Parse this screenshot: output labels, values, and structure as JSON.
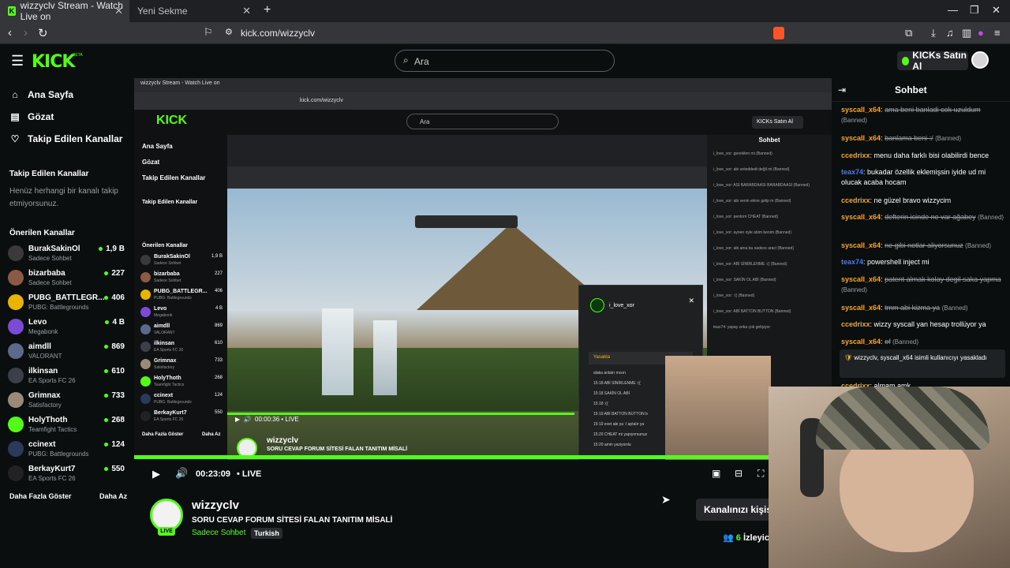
{
  "browser": {
    "tabs": [
      {
        "title": "wizzyclv Stream - Watch Live on"
      },
      {
        "title": "Yeni Sekme"
      }
    ],
    "url": "kick.com/wizzyclv"
  },
  "header": {
    "logo": "KICK",
    "logo_tag": "BETA",
    "search_placeholder": "Ara",
    "kicks_button": "KICKs Satın Al"
  },
  "sidebar": {
    "nav": [
      {
        "label": "Ana Sayfa",
        "icon": "home-icon"
      },
      {
        "label": "Gözat",
        "icon": "browse-icon"
      },
      {
        "label": "Takip Edilen Kanallar",
        "icon": "heart-icon"
      }
    ],
    "followed_title": "Takip Edilen Kanallar",
    "followed_empty": "Henüz herhangi bir kanalı takip etmiyorsunuz.",
    "recommended_title": "Önerilen Kanallar",
    "channels": [
      {
        "name": "BurakSakinOl",
        "category": "Sadece Sohbet",
        "viewers": "1,9 B",
        "color": "#3a3a3a"
      },
      {
        "name": "bizarbaba",
        "category": "Sadece Sohbet",
        "viewers": "227",
        "color": "#8a5a44"
      },
      {
        "name": "PUBG_BATTLEGR...",
        "category": "PUBG: Battlegrounds",
        "viewers": "406",
        "color": "#e8b400"
      },
      {
        "name": "Levo",
        "category": "Megabonk",
        "viewers": "4 B",
        "color": "#7b4bd6"
      },
      {
        "name": "aimdll",
        "category": "VALORANT",
        "viewers": "869",
        "color": "#5a6a8a"
      },
      {
        "name": "ilkinsan",
        "category": "EA Sports FC 26",
        "viewers": "610",
        "color": "#3a3f4a"
      },
      {
        "name": "Grimnax",
        "category": "Satisfactory",
        "viewers": "733",
        "color": "#9a8a7a"
      },
      {
        "name": "HolyThoth",
        "category": "Teamfight Tactics",
        "viewers": "268",
        "color": "#53fc18"
      },
      {
        "name": "ccinext",
        "category": "PUBG: Battlegrounds",
        "viewers": "124",
        "color": "#2a3a5a"
      },
      {
        "name": "BerkayKurt7",
        "category": "EA Sports FC 26",
        "viewers": "550",
        "color": "#222"
      }
    ],
    "show_more": "Daha Fazla Göster",
    "show_less": "Daha Az"
  },
  "player": {
    "elapsed": "00:23:09",
    "live_label": "LIVE",
    "inner_elapsed": "00:00:36"
  },
  "stream": {
    "streamer": "wizzyclv",
    "title": "SORU CEVAP FORUM SİTESİ FALAN TANITIM MİSALİ",
    "category": "Sadece Sohbet",
    "language": "Turkish",
    "live_badge": "LIVE",
    "customize_button": "Kanalınızı kişise",
    "viewers_count": "6",
    "viewers_label": "İzleyici"
  },
  "chat": {
    "title": "Sohbet",
    "messages": [
      {
        "user": "syscall_x64",
        "color": "#f5a623",
        "text": "ama beni banladi cok uzuldum",
        "deleted": true,
        "tag": "(Banned)"
      },
      {
        "user": "syscall_x64",
        "color": "#f5a623",
        "text": "banlama beni :/",
        "deleted": true,
        "tag": "(Banned)"
      },
      {
        "user": "ccedrixx",
        "color": "#f5a623",
        "text": "menu daha farklı bisi olabilirdi bence",
        "deleted": false,
        "tag": ""
      },
      {
        "user": "teax74",
        "color": "#4b7bec",
        "text": "bukadar özellik eklemişsin iyide ud mi olucak acaba hocam",
        "deleted": false,
        "tag": ""
      },
      {
        "user": "ccedrixx",
        "color": "#f5a623",
        "text": "ne güzel bravo wizzycim",
        "deleted": false,
        "tag": ""
      },
      {
        "user": "syscall_x64",
        "color": "#f5a623",
        "text": "defterin icinde ne var ağabey",
        "deleted": true,
        "tag": "(Banned)"
      },
      {
        "user": "syscall_x64",
        "color": "#f5a623",
        "text": "ne gibi notlar aliyorsunuz",
        "deleted": true,
        "tag": "(Banned)"
      },
      {
        "user": "teax74",
        "color": "#4b7bec",
        "text": "powershell inject mi",
        "deleted": false,
        "tag": ""
      },
      {
        "user": "syscall_x64",
        "color": "#f5a623",
        "text": "patent almak kolay degil saka yapma",
        "deleted": true,
        "tag": "(Banned)"
      },
      {
        "user": "syscall_x64",
        "color": "#f5a623",
        "text": "tmm abi kizma ya",
        "deleted": true,
        "tag": "(Banned)"
      },
      {
        "user": "ccedrixx",
        "color": "#f5a623",
        "text": "wizzy syscall yan hesap trollüyor ya",
        "deleted": false,
        "tag": ""
      },
      {
        "user": "syscall_x64",
        "color": "#f5a623",
        "text": "of",
        "deleted": true,
        "tag": "(Banned)"
      }
    ],
    "system": "wizzyclv, syscall_x64 isimli kullanıcıyı yasakladı",
    "partial": {
      "user": "ccedrixx",
      "text": "almam amk"
    }
  },
  "inner": {
    "tab_title": "wizzyclv Stream - Watch Live on",
    "url": "kick.com/wizzyclv",
    "search": "Ara",
    "kicks": "KICKs Satın Al",
    "nav": [
      "Ana Sayfa",
      "Gözat",
      "Takip Edilen Kanallar"
    ],
    "followed_title": "Takip Edilen Kanallar",
    "recommended_title": "Önerilen Kanallar",
    "chat_title": "Sohbet",
    "popup_user": "i_love_xor",
    "popup_ban": "Yasakla",
    "popup_lines": [
      "alaka anlatır mısın",
      "15:18 ABİ SİNİRLENME :((",
      "15:18 SAKİN OL ABİ",
      "15:18 :((",
      "15:19 ABİ BATTON BUTTON b",
      "15:19 evet abi ya :/ aptalır ya",
      "15:20 CHEAT mi yapıyorsunuz",
      "15:20 amin yaziyordu"
    ],
    "chat_lines": [
      "i_love_xor: gerekiten mi (Banned)",
      "i_love_xor: abi unteddedt değil mi (Banned)",
      "i_love_xor: ASI BARABDAASI BARABDAASI (Banned)",
      "i_love_xor: abi senin ekine gelip m (Banned)",
      "i_love_xor: pentom CHEAT (Banned)",
      "i_love_xor: aynen oyle abim benim (Banned)",
      "i_love_xor: abi ama bu sadece araci (Banned)",
      "i_love_xor: ABİ SİNİRLENME :(( (Banned)",
      "i_love_xor: SAKİN OL ABİ (Banned)",
      "i_love_xor: :(( (Banned)",
      "i_love_xor: ABİ BATTON BUTTON (Banned)",
      "teax74: yapay zeka çok gelişiyor"
    ],
    "show_more": "Daha Fazla Göster",
    "show_less": "Daha Az"
  },
  "colors": {
    "accent": "#53fc18",
    "background": "#0b0e0f",
    "panel": "#26282b"
  }
}
